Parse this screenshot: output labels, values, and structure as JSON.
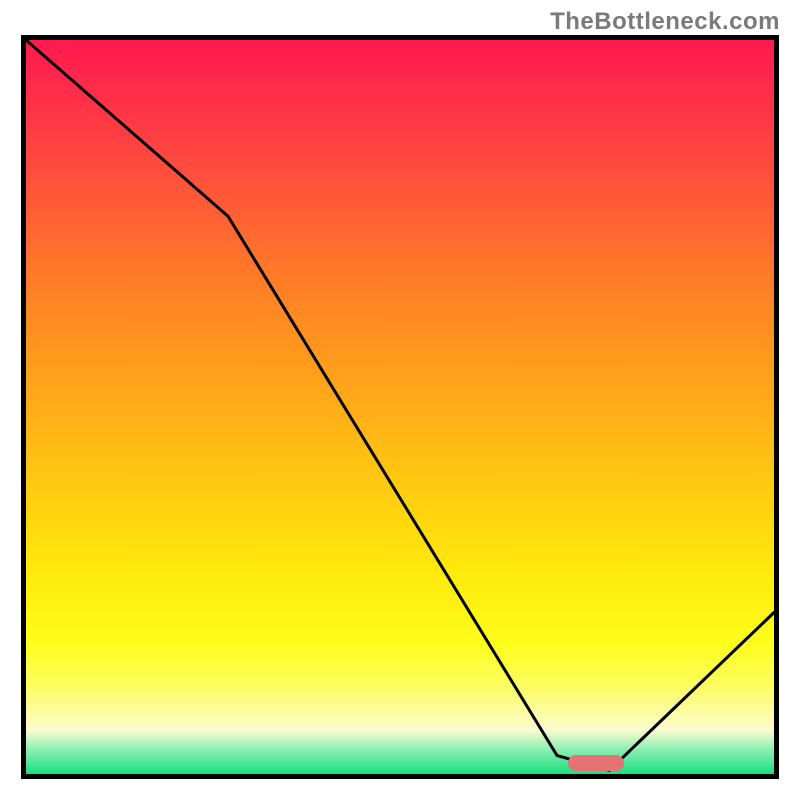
{
  "watermark": "TheBottleneck.com",
  "chart_data": {
    "type": "line",
    "title": "",
    "xlabel": "",
    "ylabel": "",
    "xlim": [
      0,
      100
    ],
    "ylim": [
      0,
      100
    ],
    "series": [
      {
        "name": "bottleneck-curve",
        "x": [
          0,
          27,
          71,
          78,
          100
        ],
        "values": [
          100,
          76,
          2.5,
          0.5,
          22
        ]
      }
    ],
    "marker": {
      "name": "optimal-region",
      "x_start": 72.5,
      "x_end": 80,
      "y": 1.5
    },
    "background_gradient": {
      "stops": [
        {
          "pos": 0,
          "color": "#ff1a4f"
        },
        {
          "pos": 50,
          "color": "#ffb216"
        },
        {
          "pos": 82,
          "color": "#fdfd1a"
        },
        {
          "pos": 100,
          "color": "#18e080"
        }
      ]
    }
  }
}
